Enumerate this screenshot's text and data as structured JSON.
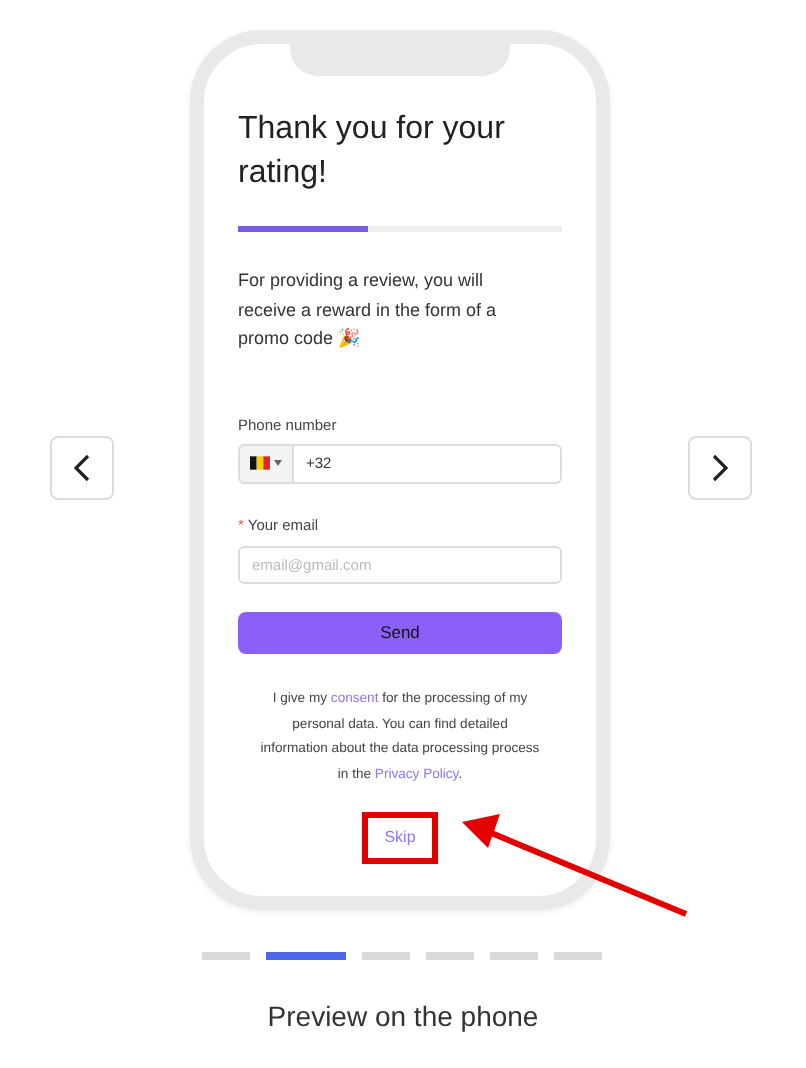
{
  "phone_screen": {
    "title": "Thank you for your rating!",
    "progress": {
      "level": 0.4
    },
    "description": "For providing a review, you will receive a reward in the form of a promo code 🎉",
    "phone_field": {
      "label": "Phone number",
      "value": "+32"
    },
    "email_field": {
      "label": "Your email",
      "required_mark": "*",
      "placeholder": "email@gmail.com"
    },
    "send_button": "Send",
    "consent": [
      {
        "kind": "text",
        "text": "I give my "
      },
      {
        "kind": "link",
        "text": "consent"
      },
      {
        "kind": "text",
        "text": " for the processing of my personal data. You can find detailed information about the data processing process in the "
      },
      {
        "kind": "link",
        "text": "Privacy Policy"
      },
      {
        "kind": "text",
        "text": "."
      }
    ],
    "skip": {
      "label": "Skip",
      "highlighted": true
    }
  },
  "pager": [
    {
      "selected": false
    },
    {
      "selected": true
    },
    {
      "selected": false
    },
    {
      "selected": false
    },
    {
      "selected": false
    },
    {
      "selected": false
    }
  ],
  "caption": "Preview on the phone"
}
